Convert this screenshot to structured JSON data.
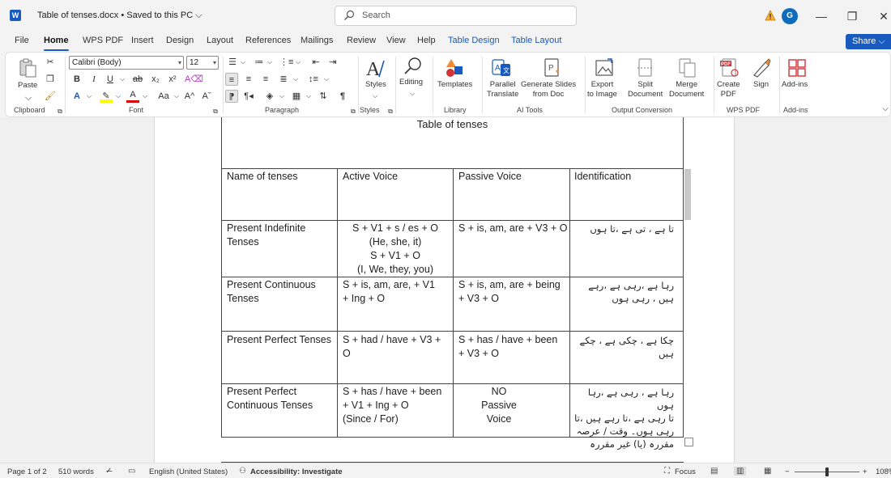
{
  "titlebar": {
    "app_icon": "W",
    "doc_title": "Table of tenses.docx  •  Saved to this PC ⌵",
    "search_placeholder": "Search",
    "avatar": "G",
    "minimize": "—",
    "maximize": "❐",
    "close": "✕"
  },
  "menu": {
    "tabs": [
      "File",
      "Home",
      "WPS PDF",
      "Insert",
      "Design",
      "Layout",
      "References",
      "Mailings",
      "Review",
      "View",
      "Help",
      "Table Design",
      "Table Layout"
    ],
    "share": "Share ⌵"
  },
  "ribbon": {
    "clipboard": {
      "paste": "Paste",
      "label": "Clipboard"
    },
    "font": {
      "family": "Calibri (Body)",
      "size": "12",
      "label": "Font",
      "bold": "B",
      "italic": "I",
      "underline": "U",
      "strike": "ab",
      "sub": "x₂",
      "sup": "x²",
      "grow": "A^",
      "shrink": "Aˇ",
      "case": "Aa"
    },
    "paragraph": {
      "label": "Paragraph",
      "pilcrow": "¶"
    },
    "styles": {
      "label": "Styles",
      "button": "Styles"
    },
    "editing": {
      "button": "Editing"
    },
    "library": {
      "templates": "Templates",
      "label": "Library"
    },
    "ai_tools": {
      "parallel": "Parallel\nTranslate",
      "slides": "Generate Slides\nfrom Doc",
      "label": "AI Tools"
    },
    "output": {
      "export": "Export\nto Image",
      "split": "Split\nDocument",
      "merge": "Merge\nDocument",
      "label": "Output Conversion"
    },
    "wps_pdf": {
      "create": "Create\nPDF",
      "sign": "Sign",
      "label": "WPS PDF"
    },
    "addins": {
      "button": "Add-ins",
      "label": "Add-ins"
    }
  },
  "document": {
    "title": "Table of tenses",
    "rows": [
      {
        "c1": "Name of tenses",
        "c2": "Active Voice",
        "c3": "Passive Voice",
        "c4": "Identification"
      },
      {
        "c1": "Present Indefinite\nTenses",
        "c2": "S + V1 + s / es + O\n(He, she, it)\nS + V1 + O\n(I, We, they, you)",
        "c3": "S + is, am, are + V3 + O",
        "c4": "تا ہے ، تی ہے ،تا ہوں"
      },
      {
        "c1": "Present Continuous\nTenses",
        "c2": "S + is, am, are, + V1\n+ Ing + O",
        "c3": "S + is, am, are + being\n+ V3 + O",
        "c4": "رہا ہے ،رہی ہے ،رہے\nہیں ، رہی ہوں"
      },
      {
        "c1": "Present Perfect Tenses",
        "c2": "S + had / have + V3 +\nO",
        "c3": "S + has / have + been\n+ V3 + O",
        "c4": "چکا ہے ، چکی ہے ، چکے\nہیں"
      },
      {
        "c1": "Present Perfect\nContinuous Tenses",
        "c2": "S + has / have + been\n+ V1 + Ing + O\n(Since / For)",
        "c3": "NO Passive\nVoice",
        "c4": "رہا ہے ، رہی ہے ،رہا ہوں\nتا رہی ہے ،تا رہے ہیں ،تا\nرہی ہوں۔ وقت / عرصہ\nمقررہ (یا) غیر مقررہ"
      }
    ]
  },
  "status": {
    "page": "Page 1 of 2",
    "words": "510 words",
    "language": "English (United States)",
    "accessibility": "Accessibility: Investigate",
    "focus": "Focus",
    "zoom_minus": "−",
    "zoom_plus": "+",
    "zoom_value": "108%"
  },
  "colors": {
    "accent": "#185abd",
    "avatar": "#0f6cbd"
  }
}
